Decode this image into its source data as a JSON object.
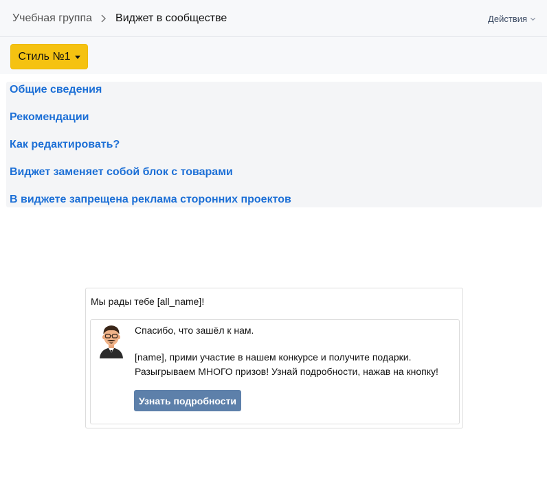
{
  "header": {
    "breadcrumb_root": "Учебная группа",
    "breadcrumb_current": "Виджет в сообществе",
    "actions_label": "Действия"
  },
  "toolbar": {
    "style_button_label": "Стиль №1"
  },
  "info_links": [
    "Общие сведения",
    "Рекомендации",
    "Как редактировать?",
    "Виджет заменяет собой блок с товарами",
    "В виджете запрещена реклама сторонних проектов"
  ],
  "widget": {
    "title": "Мы рады тебе [all_name]!",
    "message_line1": "Спасибо, что зашёл к нам.",
    "message_line2": "[name], прими участие в нашем конкурсе и получите подарки.",
    "message_line3": "Разыгрываем МНОГО призов! Узнай подробности, нажав на кнопку!",
    "button_label": "Узнать подробности"
  },
  "icons": {
    "breadcrumb_separator": "chevron-right-icon",
    "actions": "chevron-down-icon",
    "style_button": "caret-down-icon",
    "avatar": "cartoon-man-avatar"
  },
  "colors": {
    "style_button_bg": "#f5c211",
    "link": "#1c6fd6",
    "cta_bg": "#5d80aa",
    "topbar_bg": "#f7f8fa",
    "info_panel_bg": "#f4f5f7"
  }
}
